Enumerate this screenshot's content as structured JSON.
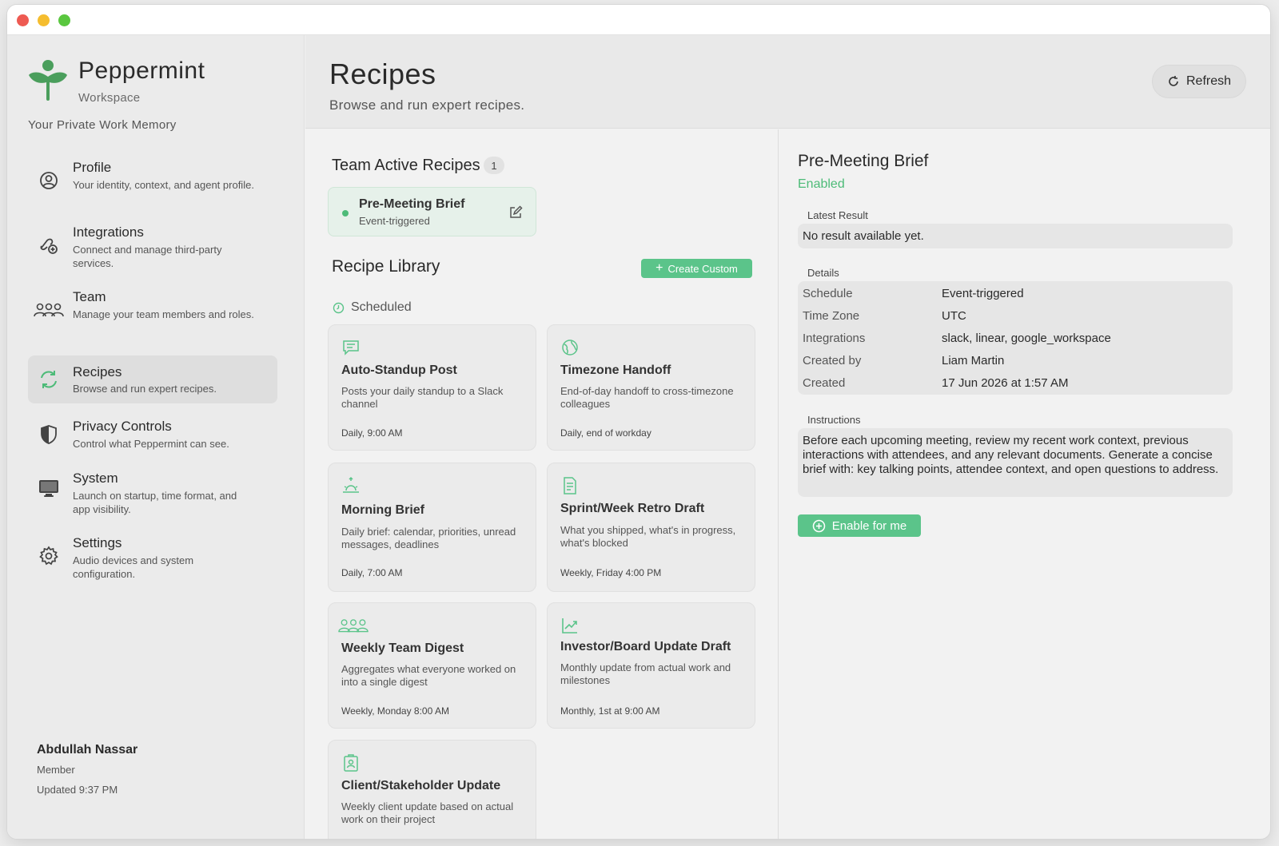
{
  "brand": {
    "name": "Peppermint",
    "sub": "Workspace",
    "tagline": "Your Private Work Memory"
  },
  "nav": [
    {
      "title": "Profile",
      "desc": "Your identity, context, and agent profile.",
      "icon": "person-circle-icon"
    },
    {
      "title": "Integrations",
      "desc": "Connect and manage third-party services.",
      "icon": "integrations-icon"
    },
    {
      "title": "Team",
      "desc": "Manage your team members and roles.",
      "icon": "team-icon"
    },
    {
      "title": "Recipes",
      "desc": "Browse and run expert recipes.",
      "icon": "refresh-cycle-icon"
    },
    {
      "title": "Privacy Controls",
      "desc": "Control what Peppermint can see.",
      "icon": "shield-icon"
    },
    {
      "title": "System",
      "desc": "Launch on startup, time format, and app visibility.",
      "icon": "monitor-icon"
    },
    {
      "title": "Settings",
      "desc": "Audio devices and system configuration.",
      "icon": "gear-icon"
    }
  ],
  "user": {
    "name": "Abdullah Nassar",
    "role": "Member",
    "updated": "Updated 9:37 PM"
  },
  "header": {
    "title": "Recipes",
    "subtitle": "Browse and run expert recipes.",
    "refresh_label": "Refresh"
  },
  "library": {
    "active_title": "Team Active Recipes",
    "active_count": "1",
    "active_recipe": {
      "title": "Pre-Meeting Brief",
      "sub": "Event-triggered"
    },
    "library_title": "Recipe Library",
    "create_label": "Create Custom",
    "scheduled_label": "Scheduled",
    "cards": [
      {
        "title": "Auto-Standup Post",
        "desc": "Posts your daily standup to a Slack channel",
        "schedule": "Daily, 9:00 AM",
        "icon": "chat-bubble-icon"
      },
      {
        "title": "Timezone Handoff",
        "desc": "End-of-day handoff to cross-timezone colleagues",
        "schedule": "Daily, end of workday",
        "icon": "globe-icon"
      },
      {
        "title": "Morning Brief",
        "desc": "Daily brief: calendar, priorities, unread messages, deadlines",
        "schedule": "Daily, 7:00 AM",
        "icon": "sunrise-icon"
      },
      {
        "title": "Sprint/Week Retro Draft",
        "desc": "What you shipped, what's in progress, what's blocked",
        "schedule": "Weekly, Friday 4:00 PM",
        "icon": "document-icon"
      },
      {
        "title": "Weekly Team Digest",
        "desc": "Aggregates what everyone worked on into a single digest",
        "schedule": "Weekly, Monday 8:00 AM",
        "icon": "team-icon"
      },
      {
        "title": "Investor/Board Update Draft",
        "desc": "Monthly update from actual work and milestones",
        "schedule": "Monthly, 1st at 9:00 AM",
        "icon": "chart-line-icon"
      },
      {
        "title": "Client/Stakeholder Update",
        "desc": "Weekly client update based on actual work on their project",
        "schedule": "",
        "icon": "id-badge-icon"
      }
    ]
  },
  "detail": {
    "title": "Pre-Meeting Brief",
    "status": "Enabled",
    "latest_label": "Latest Result",
    "latest_value": "No result available yet.",
    "details_label": "Details",
    "rows": [
      {
        "k": "Schedule",
        "v": "Event-triggered"
      },
      {
        "k": "Time Zone",
        "v": "UTC"
      },
      {
        "k": "Integrations",
        "v": "slack, linear, google_workspace"
      },
      {
        "k": "Created by",
        "v": "Liam Martin"
      },
      {
        "k": "Created",
        "v": "17 Jun 2026 at 1:57 AM"
      }
    ],
    "instructions_label": "Instructions",
    "instructions": "Before each upcoming meeting, review my recent work context, previous interactions with attendees, and any relevant documents. Generate a concise brief with: key talking points, attendee context, and open questions to address.",
    "enable_label": "Enable for me"
  },
  "colors": {
    "accent": "#5bc48a",
    "status_green": "#4dbb78",
    "brand_green": "#4a9e5c"
  }
}
